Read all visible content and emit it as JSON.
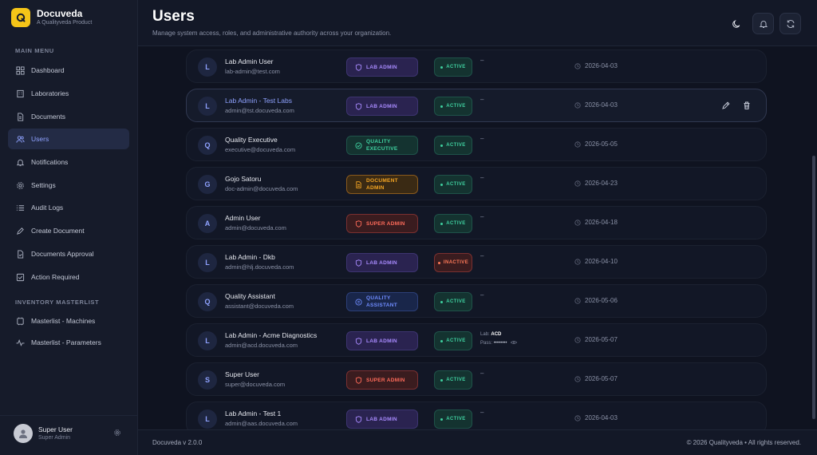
{
  "brand": {
    "name": "Docuveda",
    "subtitle": "A Qualityveda Product"
  },
  "sidebar": {
    "main_menu_label": "MAIN MENU",
    "inventory_label": "INVENTORY MASTERLIST",
    "items": [
      {
        "label": "Dashboard",
        "icon": "grid-icon"
      },
      {
        "label": "Laboratories",
        "icon": "building-icon"
      },
      {
        "label": "Documents",
        "icon": "document-icon"
      },
      {
        "label": "Users",
        "icon": "users-icon",
        "active": true
      },
      {
        "label": "Notifications",
        "icon": "bell-icon"
      },
      {
        "label": "Settings",
        "icon": "gear-icon"
      },
      {
        "label": "Audit Logs",
        "icon": "list-icon"
      },
      {
        "label": "Create Document",
        "icon": "edit-document-icon"
      },
      {
        "label": "Documents Approval",
        "icon": "document-check-icon"
      },
      {
        "label": "Action Required",
        "icon": "checkbox-icon"
      }
    ],
    "inventory_items": [
      {
        "label": "Masterlist - Machines",
        "icon": "machine-icon"
      },
      {
        "label": "Masterlist - Parameters",
        "icon": "activity-icon"
      }
    ],
    "user": {
      "name": "Super User",
      "role": "Super Admin"
    }
  },
  "header": {
    "title": "Users",
    "subtitle": "Manage system access, roles, and administrative authority across your organization."
  },
  "users": [
    {
      "initial": "L",
      "name": "Lab Admin User",
      "email": "lab-admin@test.com",
      "role": "LAB ADMIN",
      "role_type": "lab",
      "status": "ACTIVE",
      "cred": "–",
      "date": "2026-04-03"
    },
    {
      "initial": "L",
      "name": "Lab Admin - Test Labs",
      "email": "admin@tst.docuveda.com",
      "role": "LAB ADMIN",
      "role_type": "lab",
      "status": "ACTIVE",
      "cred": "–",
      "date": "2026-04-03"
    },
    {
      "initial": "Q",
      "name": "Quality Executive",
      "email": "executive@docuveda.com",
      "role": "QUALITY EXECUTIVE",
      "role_type": "qe",
      "status": "ACTIVE",
      "cred": "–",
      "date": "2026-05-05"
    },
    {
      "initial": "G",
      "name": "Gojo Satoru",
      "email": "doc-admin@docuveda.com",
      "role": "DOCUMENT ADMIN",
      "role_type": "doc",
      "status": "ACTIVE",
      "cred": "–",
      "date": "2026-04-23"
    },
    {
      "initial": "A",
      "name": "Admin User",
      "email": "admin@docuveda.com",
      "role": "SUPER ADMIN",
      "role_type": "super",
      "status": "ACTIVE",
      "cred": "–",
      "date": "2026-04-18"
    },
    {
      "initial": "L",
      "name": "Lab Admin - Dkb",
      "email": "admin@hlj.docuveda.com",
      "role": "LAB ADMIN",
      "role_type": "lab",
      "status": "INACTIVE",
      "cred": "–",
      "date": "2026-04-10"
    },
    {
      "initial": "Q",
      "name": "Quality Assistant",
      "email": "assistant@docuveda.com",
      "role": "QUALITY ASSISTANT",
      "role_type": "qa",
      "status": "ACTIVE",
      "cred": "–",
      "date": "2026-05-06"
    },
    {
      "initial": "L",
      "name": "Lab Admin - Acme Diagnostics",
      "email": "admin@acd.docuveda.com",
      "role": "LAB ADMIN",
      "role_type": "lab",
      "status": "ACTIVE",
      "cred_lab_label": "Lab:",
      "cred_lab": "ACD",
      "cred_pass_label": "Pass:",
      "cred_pass": "••••••••",
      "date": "2026-05-07"
    },
    {
      "initial": "S",
      "name": "Super User",
      "email": "super@docuveda.com",
      "role": "SUPER ADMIN",
      "role_type": "super",
      "status": "ACTIVE",
      "cred": "–",
      "date": "2026-05-07"
    },
    {
      "initial": "L",
      "name": "Lab Admin - Test 1",
      "email": "admin@aas.docuveda.com",
      "role": "LAB ADMIN",
      "role_type": "lab",
      "status": "ACTIVE",
      "cred": "–",
      "date": "2026-04-03"
    }
  ],
  "colors": {
    "accent": "#8fa2ff",
    "brand": "#f5c518",
    "active": "#3fd1a0",
    "inactive": "#ff7a59"
  },
  "footer": {
    "version": "Docuveda v 2.0.0",
    "copyright": "© 2026 Qualityveda • All rights reserved."
  }
}
